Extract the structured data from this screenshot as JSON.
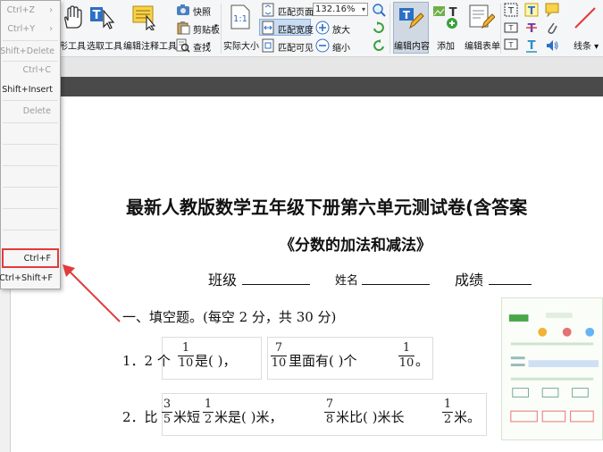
{
  "ribbon": {
    "tools": [
      {
        "label": "形工具"
      },
      {
        "label": "选取工具"
      },
      {
        "label": "编辑注释工具"
      }
    ],
    "snapshot": "快照",
    "clipboard": "剪贴板",
    "find": "查找",
    "actual_size": "实际大小",
    "fit_page": "匹配页面",
    "fit_width": "匹配宽度",
    "fit_visible": "匹配可见",
    "zoom_value": "132.16%",
    "zoom_in": "放大",
    "zoom_out": "缩小",
    "edit_content": "编辑内容",
    "add": "添加",
    "edit_form": "编辑表单",
    "lines": "线条"
  },
  "context_menu": {
    "items": [
      {
        "shortcut": "Ctrl+Z",
        "enabled": false
      },
      {
        "shortcut": "Ctrl+Y",
        "enabled": false
      },
      {
        "shortcut": "Shift+Delete",
        "enabled": false
      },
      {
        "shortcut": "Ctrl+C",
        "enabled": false
      },
      {
        "shortcut": "Shift+Insert",
        "enabled": true
      },
      {
        "shortcut": "Delete",
        "enabled": false
      },
      {
        "shortcut": "Ctrl+F",
        "enabled": true
      },
      {
        "shortcut": "Ctrl+Shift+F",
        "enabled": true
      }
    ]
  },
  "document": {
    "title": "最新人教版数学五年级下册第六单元测试卷(含答案",
    "subtitle": "《分数的加法和减法》",
    "class_label": "班级",
    "name_label": "姓名",
    "score_label": "成绩",
    "section1": "一、填空题。(每空 2 分，共 30 分)",
    "q1": {
      "num": "1．2 个",
      "f1": {
        "n": "1",
        "d": "10"
      },
      "t1": "是(        )，",
      "f2": {
        "n": "7",
        "d": "10"
      },
      "t2": "里面有(        )个",
      "f3": {
        "n": "1",
        "d": "10"
      },
      "t3": "。"
    },
    "q2": {
      "num": "2．比",
      "f1": {
        "n": "3",
        "d": "5"
      },
      "t1": "米短",
      "f2": {
        "n": "1",
        "d": "2"
      },
      "t2": "米是(        )米，",
      "f3": {
        "n": "7",
        "d": "8"
      },
      "t3": "米比(        )米长",
      "f4": {
        "n": "1",
        "d": "2"
      },
      "t4": "米。"
    }
  },
  "colors": {
    "annotation_red": "#e23b3b",
    "ribbon_bg": "#f5f6f7",
    "dark_band": "#4a4a4a"
  }
}
